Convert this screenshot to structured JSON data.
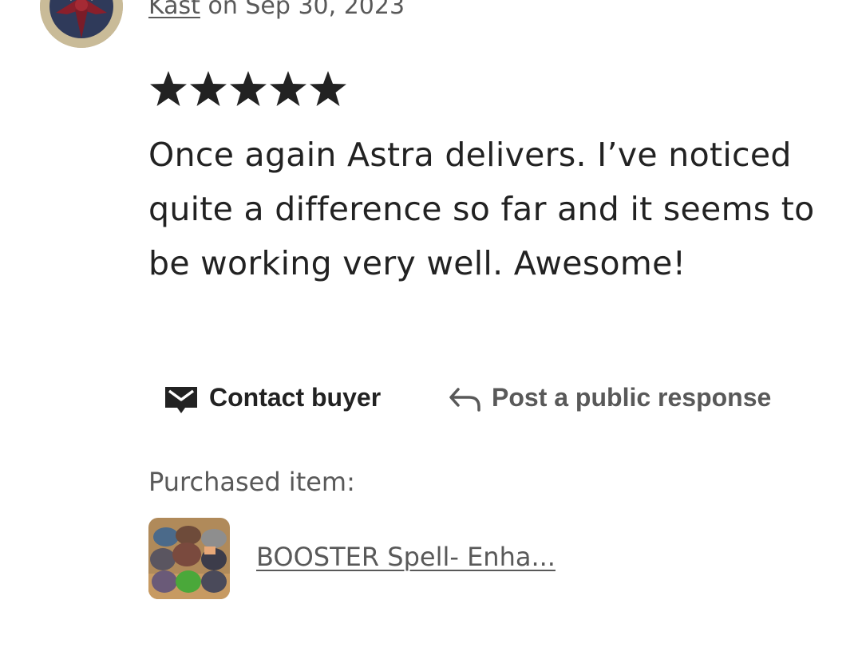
{
  "review": {
    "username": "Kast",
    "date_text": "on Sep 30, 2023",
    "rating": 5,
    "rating_max": 5,
    "text": "Once again Astra delivers. I’ve noticed quite a difference so far and it seems to be working very well. Awesome!"
  },
  "actions": {
    "contact_label": "Contact buyer",
    "contact_icon": "envelope-icon",
    "respond_label": "Post a public response",
    "respond_icon": "reply-arrow-icon"
  },
  "purchase": {
    "label": "Purchased item:",
    "item_title": "BOOSTER Spell- Enha..."
  },
  "colors": {
    "text_primary": "#222222",
    "text_secondary": "#595959",
    "background": "#ffffff"
  }
}
